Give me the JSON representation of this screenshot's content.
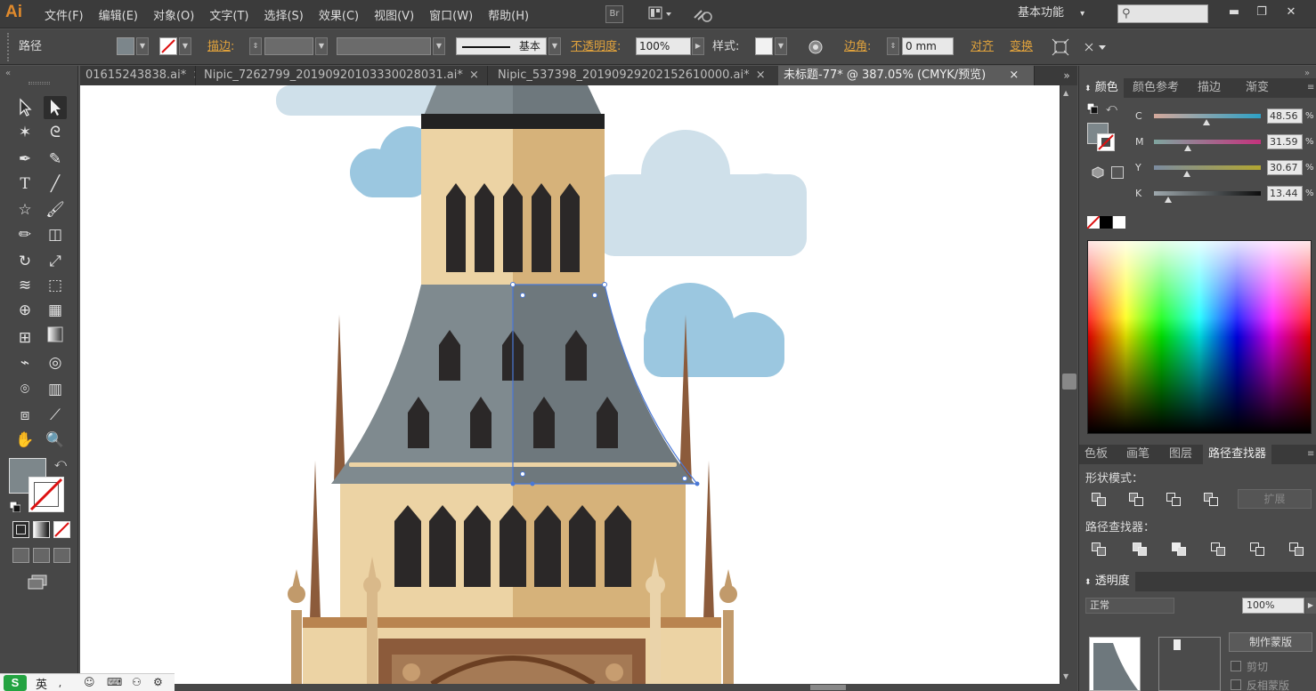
{
  "app": {
    "logo": "Ai"
  },
  "menu": [
    "文件(F)",
    "编辑(E)",
    "对象(O)",
    "文字(T)",
    "选择(S)",
    "效果(C)",
    "视图(V)",
    "窗口(W)",
    "帮助(H)"
  ],
  "menubar": {
    "bridge": "Br",
    "workspace": "基本功能",
    "workspace_arrow": "▾",
    "search_placeholder": ""
  },
  "window_controls": {
    "minimize": "▬",
    "restore": "❐",
    "close": "✕"
  },
  "control": {
    "object_type": "路径",
    "stroke_label": "描边",
    "stroke_colon": ":",
    "stroke_profile": "基本",
    "opacity_label": "不透明度",
    "opacity_colon": ":",
    "opacity_value": "100%",
    "style_label": "样式",
    "style_colon": ":",
    "corner_label": "边角",
    "corner_colon": ":",
    "corner_value": "0 mm",
    "align": "对齐",
    "transform": "变换"
  },
  "tabs": [
    {
      "label": "01615243838.ai*",
      "close": "×"
    },
    {
      "label": "Nipic_7262799_20190920103330028031.ai*",
      "close": "×"
    },
    {
      "label": "Nipic_537398_20190929202152610000.ai*",
      "close": "×"
    },
    {
      "label": "未标题-77* @ 387.05% (CMYK/预览)",
      "close": "×"
    }
  ],
  "tabs_more": "»",
  "color_panel": {
    "tabs": [
      "颜色",
      "颜色参考",
      "描边",
      "渐变"
    ],
    "channels": [
      {
        "name": "C",
        "value": "48.56",
        "fraction": 0.49
      },
      {
        "name": "M",
        "value": "31.59",
        "fraction": 0.32
      },
      {
        "name": "Y",
        "value": "30.67",
        "fraction": 0.31
      },
      {
        "name": "K",
        "value": "13.44",
        "fraction": 0.13
      }
    ],
    "percent": "%"
  },
  "pathfinder_panel": {
    "tabs": [
      "色板",
      "画笔",
      "图层",
      "路径查找器"
    ],
    "shape_modes_label": "形状模式：",
    "expand": "扩展",
    "pathfinders_label": "路径查找器："
  },
  "transparency_panel": {
    "title": "透明度",
    "mode_prefix": "正常",
    "value": "100%",
    "make_mask": "制作蒙版",
    "clip": "剪切",
    "invert_mask": "反相蒙版"
  },
  "ime": {
    "label": "英"
  },
  "colors": {
    "tower_light": "#ecd3a4",
    "tower_shade": "#d6b27a",
    "roof_light": "#7f8a8f",
    "roof_dark": "#6e787d",
    "window": "#2b2828",
    "cloud_light": "#cfe0ea",
    "cloud_blue": "#9bc7e0",
    "spire": "#8c5b3b",
    "selection": "#4a78d6",
    "accent": "#e0a23c"
  }
}
